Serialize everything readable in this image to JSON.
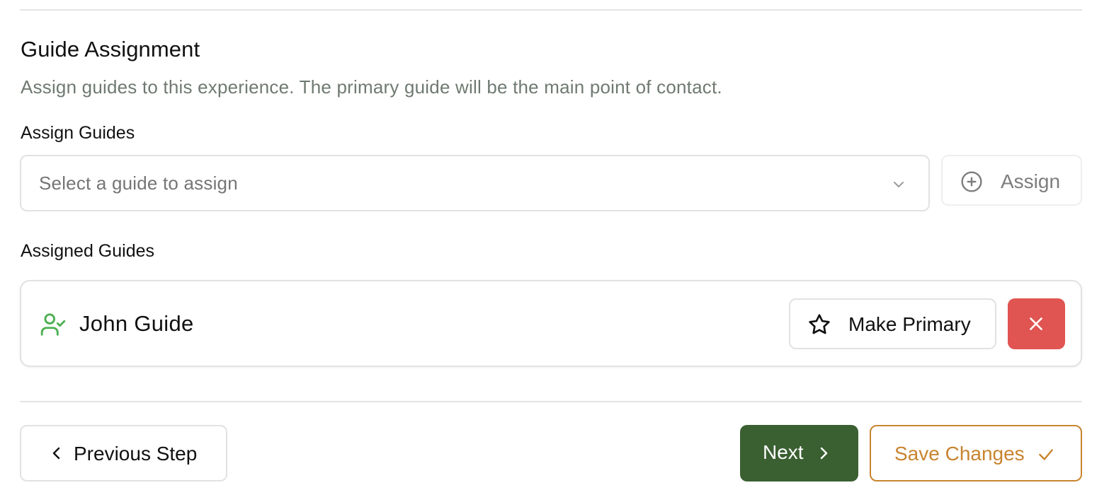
{
  "section": {
    "title": "Guide Assignment",
    "subtitle": "Assign guides to this experience. The primary guide will be the main point of contact."
  },
  "assign": {
    "label": "Assign Guides",
    "select_placeholder": "Select a guide to assign",
    "select_icon": "chevron-down-icon",
    "button_label": "Assign",
    "button_icon": "plus-circle-icon",
    "button_disabled": true
  },
  "assigned": {
    "label": "Assigned Guides",
    "guides": [
      {
        "name": "John Guide",
        "icon": "user-check-icon",
        "make_primary_label": "Make Primary",
        "make_primary_icon": "star-icon",
        "remove_icon": "close-icon"
      }
    ]
  },
  "footer": {
    "previous_label": "Previous Step",
    "next_label": "Next",
    "save_label": "Save Changes"
  },
  "colors": {
    "primary_green": "#3a5f31",
    "accent_orange": "#c8842f",
    "danger_red": "#e05451",
    "user_icon_green": "#4caf50",
    "muted_text": "#6f7a71"
  }
}
